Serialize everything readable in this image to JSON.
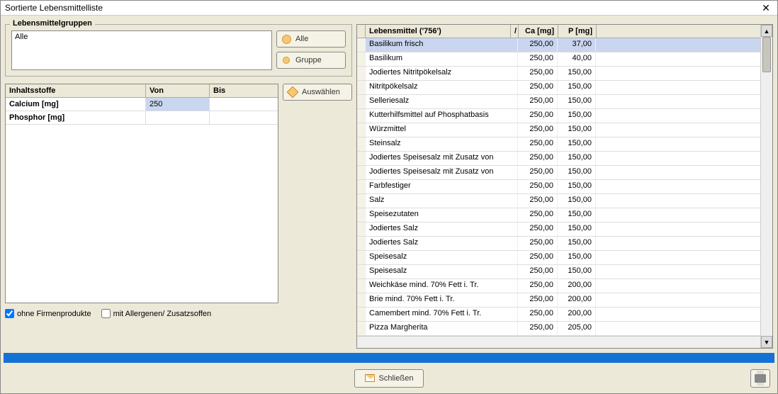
{
  "window": {
    "title": "Sortierte Lebensmittelliste"
  },
  "groups": {
    "legend": "Lebensmittelgruppen",
    "list_value": "Alle",
    "btn_all": "Alle",
    "btn_group": "Gruppe"
  },
  "ingredients": {
    "header": {
      "name": "Inhaltsstoffe",
      "von": "Von",
      "bis": "Bis"
    },
    "rows": [
      {
        "name": "Calcium [mg]",
        "von": "250",
        "bis": ""
      },
      {
        "name": "Phosphor [mg]",
        "von": "",
        "bis": ""
      }
    ],
    "btn_select": "Auswählen"
  },
  "checkboxes": {
    "ohne_firma": {
      "label": "ohne Firmenprodukte",
      "checked": true
    },
    "mit_allerg": {
      "label": "mit Allergenen/ Zusatzsoffen",
      "checked": false
    }
  },
  "foods": {
    "header": {
      "name": "Lebensmittel ('756')",
      "sort": "/",
      "ca": "Ca [mg]",
      "p": "P [mg]"
    },
    "rows": [
      {
        "name": "Basilikum frisch",
        "ca": "250,00",
        "p": "37,00",
        "selected": true
      },
      {
        "name": "Basilikum",
        "ca": "250,00",
        "p": "40,00"
      },
      {
        "name": "Jodiertes Nitritpökelsalz",
        "ca": "250,00",
        "p": "150,00"
      },
      {
        "name": "Nitritpökelsalz",
        "ca": "250,00",
        "p": "150,00"
      },
      {
        "name": "Selleriesalz",
        "ca": "250,00",
        "p": "150,00"
      },
      {
        "name": "Kutterhilfsmittel auf Phosphatbasis",
        "ca": "250,00",
        "p": "150,00"
      },
      {
        "name": "Würzmittel",
        "ca": "250,00",
        "p": "150,00"
      },
      {
        "name": "Steinsalz",
        "ca": "250,00",
        "p": "150,00"
      },
      {
        "name": "Jodiertes Speisesalz mit Zusatz von",
        "ca": "250,00",
        "p": "150,00"
      },
      {
        "name": "Jodiertes Speisesalz mit Zusatz von",
        "ca": "250,00",
        "p": "150,00"
      },
      {
        "name": "Farbfestiger",
        "ca": "250,00",
        "p": "150,00"
      },
      {
        "name": "Salz",
        "ca": "250,00",
        "p": "150,00"
      },
      {
        "name": "Speisezutaten",
        "ca": "250,00",
        "p": "150,00"
      },
      {
        "name": "Jodiertes Salz",
        "ca": "250,00",
        "p": "150,00"
      },
      {
        "name": "Jodiertes Salz",
        "ca": "250,00",
        "p": "150,00"
      },
      {
        "name": "Speisesalz",
        "ca": "250,00",
        "p": "150,00"
      },
      {
        "name": "Speisesalz",
        "ca": "250,00",
        "p": "150,00"
      },
      {
        "name": "Weichkäse mind. 70% Fett i. Tr.",
        "ca": "250,00",
        "p": "200,00"
      },
      {
        "name": "Brie mind. 70% Fett i. Tr.",
        "ca": "250,00",
        "p": "200,00"
      },
      {
        "name": "Camembert mind. 70% Fett i. Tr.",
        "ca": "250,00",
        "p": "200,00"
      },
      {
        "name": "Pizza Margherita",
        "ca": "250,00",
        "p": "205,00"
      }
    ]
  },
  "footer": {
    "close": "Schließen"
  }
}
